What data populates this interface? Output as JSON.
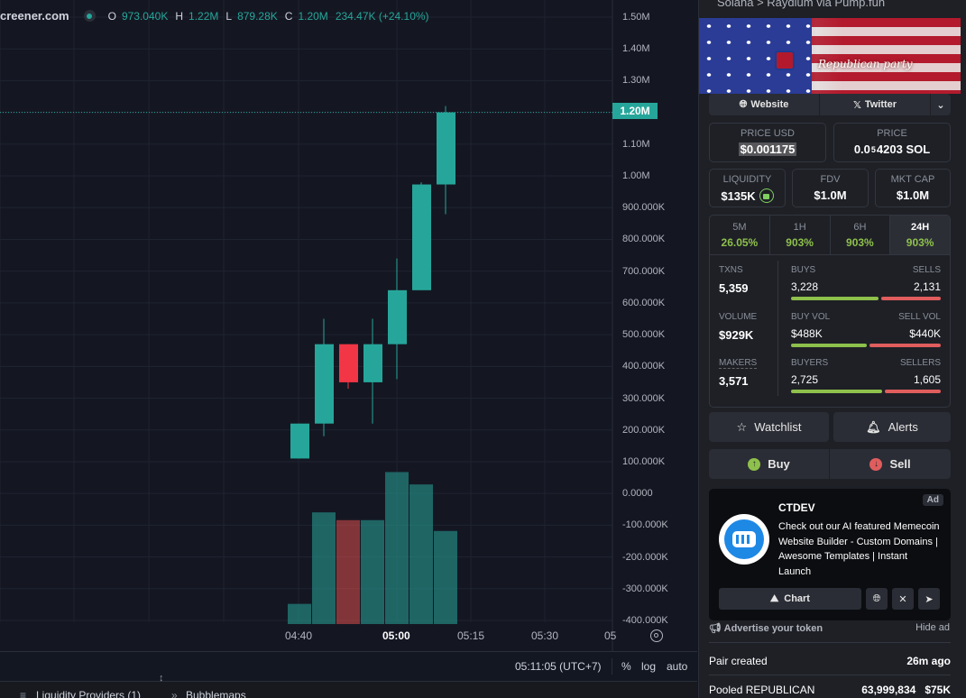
{
  "chart": {
    "site": "creener.com",
    "ohlc": {
      "o_label": "O",
      "o": "973.040K",
      "h_label": "H",
      "h": "1.22M",
      "l_label": "L",
      "l": "879.28K",
      "c_label": "C",
      "c": "1.20M",
      "change": "234.47K (+24.10%)"
    },
    "current_price": "1.20M",
    "price_ticks": [
      "1.50M",
      "1.40M",
      "1.30M",
      "1.20M",
      "1.10M",
      "1.00M",
      "900.000K",
      "800.000K",
      "700.000K",
      "600.000K",
      "500.000K",
      "400.000K",
      "300.000K",
      "200.000K",
      "100.000K",
      "0.0000",
      "-100.000K",
      "-200.000K",
      "-300.000K",
      "-400.000K"
    ],
    "time_ticks": [
      "04:40",
      "05:00",
      "05:15",
      "05:30",
      "05"
    ],
    "timezone": "05:11:05 (UTC+7)",
    "options": {
      "percent": "%",
      "log": "log",
      "auto": "auto"
    },
    "colors": {
      "up": "#26a69a",
      "down": "#ef5350",
      "bg": "#141722"
    }
  },
  "chart_data": {
    "type": "candlestick",
    "title": "",
    "categories": [
      "04:40",
      "04:45",
      "04:50",
      "04:55",
      "05:00",
      "05:05",
      "05:10"
    ],
    "open": [
      110000,
      220000,
      470000,
      350000,
      470000,
      640000,
      973040
    ],
    "high": [
      220000,
      550000,
      470000,
      550000,
      740000,
      980000,
      1220000
    ],
    "low": [
      110000,
      180000,
      330000,
      220000,
      360000,
      640000,
      879280
    ],
    "close": [
      220000,
      470000,
      350000,
      470000,
      640000,
      973040,
      1200000
    ],
    "volume_relative": [
      0.13,
      0.72,
      0.67,
      0.67,
      0.98,
      0.9,
      0.6
    ],
    "volume_direction": [
      "up",
      "up",
      "down",
      "up",
      "up",
      "up",
      "up"
    ],
    "ylim": [
      -400000,
      1500000
    ]
  },
  "bottom": {
    "tab1": "Liquidity Providers (1)",
    "tab2": "Bubblemaps"
  },
  "panel": {
    "chain": "Solana  >  Raydium  via  Pump.fun",
    "banner_text": "Republican party",
    "website": "Website",
    "twitter": "Twitter",
    "price_usd_label": "PRICE USD",
    "price_usd": "$0.001175",
    "price_sol_label": "PRICE",
    "price_sol_prefix": "0.0",
    "price_sol_sub": "5",
    "price_sol_rest": "4203 SOL",
    "liquidity_label": "LIQUIDITY",
    "liquidity": "$135K",
    "fdv_label": "FDV",
    "fdv": "$1.0M",
    "mktcap_label": "MKT CAP",
    "mktcap": "$1.0M",
    "timeframes": [
      {
        "name": "5M",
        "pct": "26.05%"
      },
      {
        "name": "1H",
        "pct": "903%"
      },
      {
        "name": "6H",
        "pct": "903%"
      },
      {
        "name": "24H",
        "pct": "903%"
      }
    ],
    "stats": {
      "txns_label": "TXNS",
      "txns": "5,359",
      "buys_label": "BUYS",
      "buys": "3,228",
      "sells_label": "SELLS",
      "sells": "2,131",
      "volume_label": "VOLUME",
      "volume": "$929K",
      "buyvol_label": "BUY VOL",
      "buyvol": "$488K",
      "sellvol_label": "SELL VOL",
      "sellvol": "$440K",
      "makers_label": "MAKERS",
      "makers": "3,571",
      "buyers_label": "BUYERS",
      "buyers": "2,725",
      "sellers_label": "SELLERS",
      "sellers": "1,605",
      "buy_share": 0.602,
      "buyvol_share": 0.526,
      "buyers_share": 0.629
    },
    "watchlist": "Watchlist",
    "alerts": "Alerts",
    "buy": "Buy",
    "sell": "Sell",
    "ad": {
      "name": "CTDEV",
      "tag": "Ad",
      "desc": "Check out our AI featured Memecoin Website Builder - Custom Domains | Awesome Templates | Instant Launch",
      "chart": "Chart"
    },
    "advertise": "Advertise your token",
    "hide_ad": "Hide ad",
    "pair_created_label": "Pair created",
    "pair_created": "26m ago",
    "pooled_label": "Pooled REPUBLICAN",
    "pooled_amount": "63,999,834",
    "pooled_usd": "$75K"
  }
}
